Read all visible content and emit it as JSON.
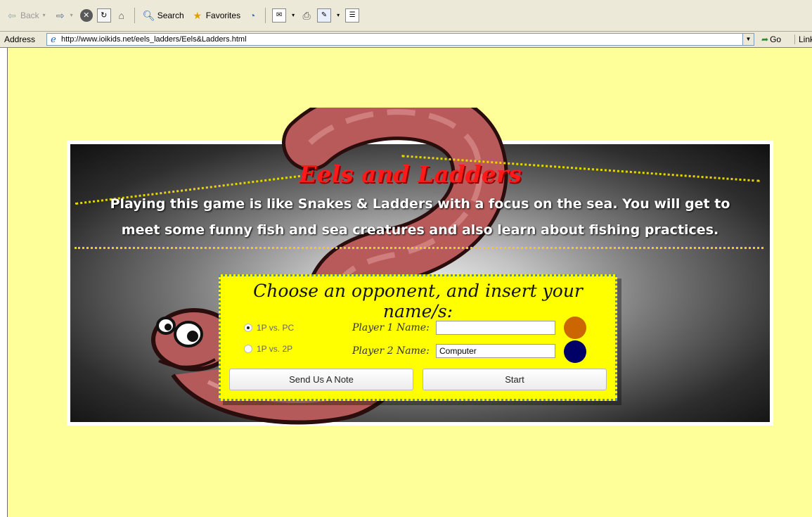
{
  "browser": {
    "toolbar": {
      "back_label": "Back",
      "search_label": "Search",
      "favorites_label": "Favorites"
    },
    "address": {
      "label": "Address",
      "url": "http://www.ioikids.net/eels_ladders/Eels&Ladders.html",
      "go_label": "Go",
      "links_label": "Link"
    }
  },
  "game": {
    "title": "Eels and Ladders",
    "intro_line1": "Playing this game is like Snakes & Ladders with a focus on the sea. You will get to",
    "intro_line2": "meet some funny fish and sea creatures and also learn about fishing practices.",
    "colors": {
      "page_background": "#ffff99",
      "title": "#ff1a1a",
      "panel": "#ffff00",
      "player1_token": "#cc6600",
      "player2_token": "#000066"
    },
    "form": {
      "heading": "Choose an opponent, and insert your name/s:",
      "options": [
        {
          "label": "1P vs. PC",
          "selected": true
        },
        {
          "label": "1P vs. 2P",
          "selected": false
        }
      ],
      "player1_label": "Player 1 Name:",
      "player1_value": "",
      "player2_label": "Player 2 Name:",
      "player2_value": "Computer",
      "send_note_label": "Send Us A Note",
      "start_label": "Start"
    }
  }
}
